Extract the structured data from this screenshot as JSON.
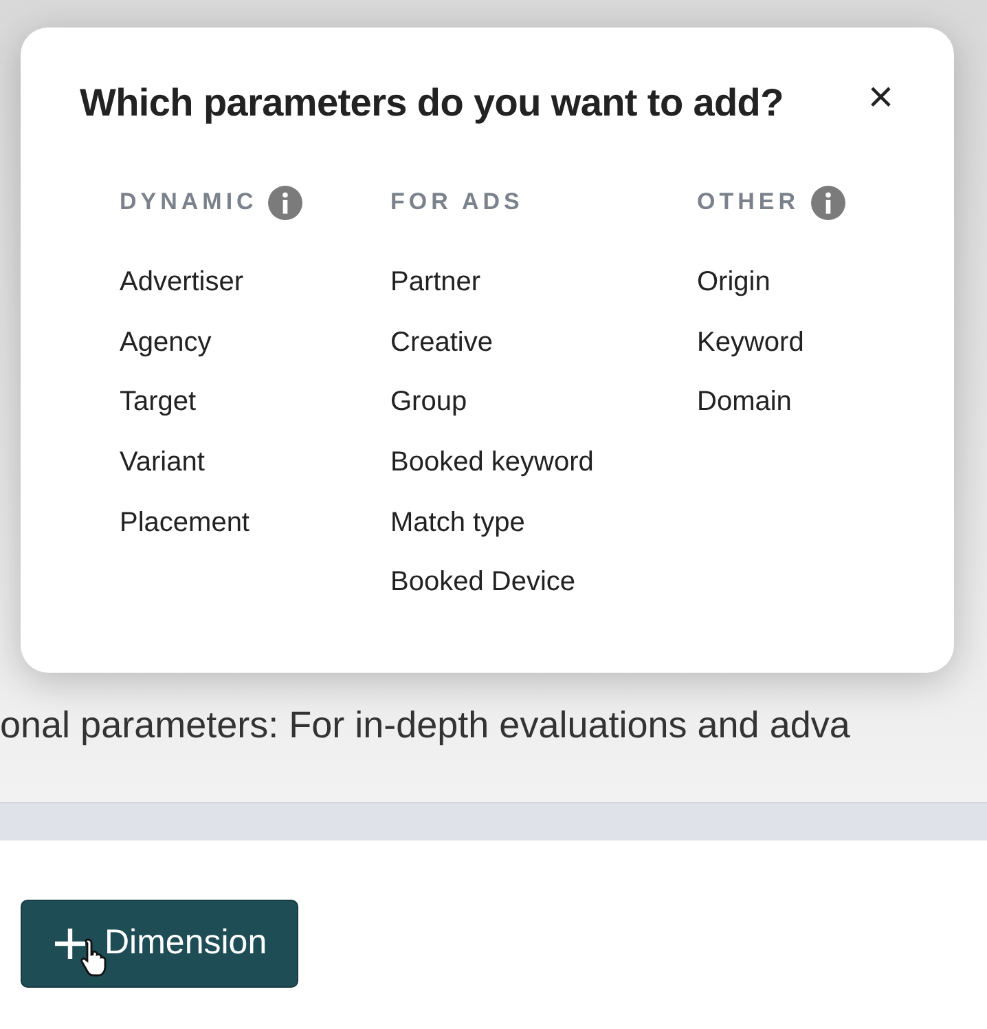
{
  "dialog": {
    "title": "Which parameters do you want to add?",
    "close": "×",
    "columns": [
      {
        "heading": "DYNAMIC",
        "info_icon": true,
        "items": [
          "Advertiser",
          "Agency",
          "Target",
          "Variant",
          "Placement"
        ]
      },
      {
        "heading": "FOR ADS",
        "info_icon": false,
        "items": [
          "Partner",
          "Creative",
          "Group",
          "Booked keyword",
          "Match type",
          "Booked Device"
        ]
      },
      {
        "heading": "OTHER",
        "info_icon": true,
        "items": [
          "Origin",
          "Keyword",
          "Domain"
        ]
      }
    ]
  },
  "description": "onal parameters: For in-depth evaluations and adva",
  "add_button": {
    "label": "Dimension"
  }
}
